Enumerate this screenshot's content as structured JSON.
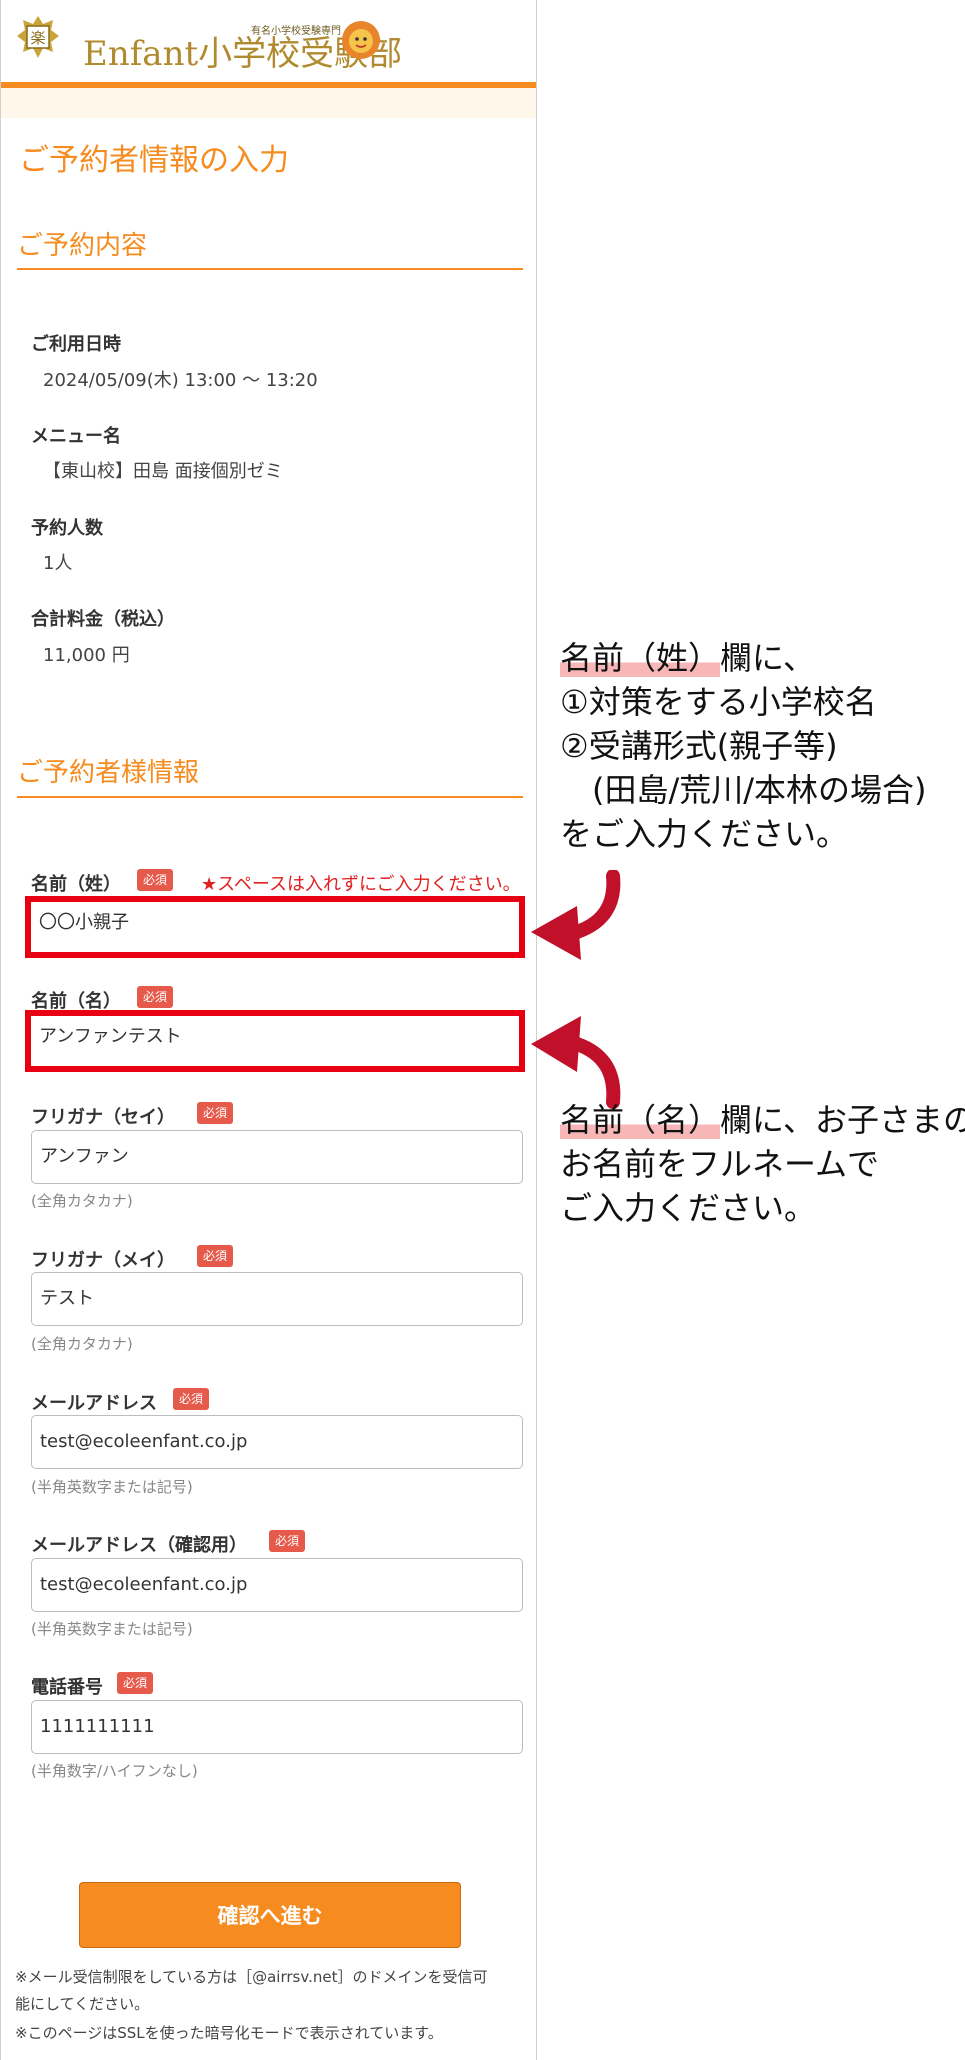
{
  "header": {
    "logo_brand": "Enfant小学校受験部",
    "logo_tagline": "有名小学校受験専門",
    "crest_glyph": "楽"
  },
  "page_title": "ご予約者情報の入力",
  "reservation": {
    "section_title": "ご予約内容",
    "items": [
      {
        "label": "ご利用日時",
        "value": "2024/05/09(木) 13:00 〜 13:20"
      },
      {
        "label": "メニュー名",
        "value": "【東山校】田島 面接個別ゼミ"
      },
      {
        "label": "予約人数",
        "value": "1人"
      },
      {
        "label": "合計料金（税込）",
        "value": "11,000 円"
      }
    ]
  },
  "customer": {
    "section_title": "ご予約者様情報",
    "required_badge": "必須",
    "space_warning": "★スペースは入れずにご入力ください。",
    "fields": {
      "last_name": {
        "label": "名前（姓）",
        "value": "〇〇小親子"
      },
      "first_name": {
        "label": "名前（名）",
        "value": "アンファンテスト"
      },
      "kana_last": {
        "label": "フリガナ（セイ）",
        "value": "アンファン",
        "hint": "(全角カタカナ)"
      },
      "kana_first": {
        "label": "フリガナ（メイ）",
        "value": "テスト",
        "hint": "(全角カタカナ)"
      },
      "email": {
        "label": "メールアドレス",
        "value": "test@ecoleenfant.co.jp",
        "hint": "(半角英数字または記号)"
      },
      "email_confirm": {
        "label": "メールアドレス（確認用）",
        "value": "test@ecoleenfant.co.jp",
        "hint": "(半角英数字または記号)"
      },
      "phone": {
        "label": "電話番号",
        "value": "1111111111",
        "hint": "(半角数字/ハイフンなし)"
      }
    }
  },
  "submit_label": "確認へ進む",
  "footnotes": [
    "※メール受信制限をしている方は［@airrsv.net］のドメインを受信可",
    "能にしてください。",
    "※このページはSSLを使った暗号化モードで表示されています。"
  ],
  "annotations": {
    "top": [
      "名前（姓）欄に、",
      "①対策をする小学校名",
      "②受講形式(親子等)",
      "　(田島/荒川/本林の場合)",
      "をご入力ください。"
    ],
    "bottom": [
      "名前（名）欄に、お子さまの",
      "お名前をフルネームで",
      "ご入力ください。"
    ],
    "top_highlight": "名前（姓）",
    "bottom_highlight": "名前（名）"
  },
  "colors": {
    "accent": "#f68b1f",
    "highlight_box": "#e60012",
    "badge": "#e65a4b",
    "arrow": "#c0102a"
  }
}
